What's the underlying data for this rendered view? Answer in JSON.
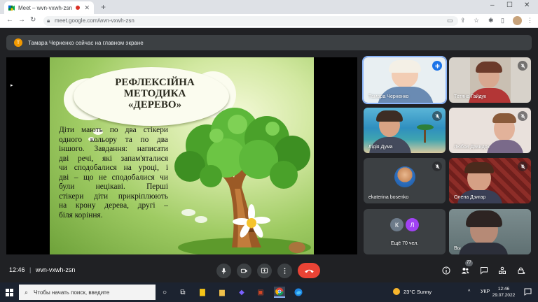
{
  "browser": {
    "tab_title": "Meet – wvn-vxwh-zsn",
    "tab_close": "✕",
    "new_tab": "+",
    "url": "meet.google.com/wvn-vxwh-zsn",
    "window_controls": [
      "–",
      "☐",
      "✕"
    ]
  },
  "banner": {
    "avatar_letter": "Т",
    "text": "Тамара Черненко сейчас на главном экране"
  },
  "slide": {
    "title_lines": [
      "РЕФЛЕКСІЙНА",
      "МЕТОДИКА",
      "«ДЕРЕВО»"
    ],
    "body_lines": [
      "Діти мають по два стікери",
      "одного кольору та по два",
      "іншого. Завдання: написати",
      "дві речі, які запам'яталися",
      "чи сподобалися на уроці, і",
      "дві – що не сподобалися чи",
      "були нецікаві. Перші",
      "стікери діти прикріплюють",
      "на крону дерева, другі –",
      "біля коріння."
    ]
  },
  "participants": [
    {
      "name": "Тамара Черненко",
      "mic": "speaking"
    },
    {
      "name": "Тетяна Гайдук",
      "mic": "muted"
    },
    {
      "name": "Лідія Дума",
      "mic": "muted"
    },
    {
      "name": "Любов Давидок",
      "mic": "muted"
    },
    {
      "name": "ekaterina bosenko",
      "mic": "muted"
    },
    {
      "name": "Олена Дзигар",
      "mic": "muted"
    },
    {
      "name": "Ещё 70 чел.",
      "avatars": [
        "К",
        "Л"
      ],
      "avatar_colors": [
        "#6d7b8a",
        "#a142f4"
      ]
    },
    {
      "name": "Вы",
      "mic": "none"
    }
  ],
  "meeting": {
    "time": "12:46",
    "code": "wvn-vxwh-zsn",
    "people_count": "77"
  },
  "taskbar": {
    "search_placeholder": "Чтобы начать поиск, введите",
    "weather": "23°C  Sunny",
    "language": "УКР",
    "time": "12:46",
    "date": "29.07.2022"
  },
  "colors": {
    "accent_blue": "#8ab4f8",
    "end_call_red": "#ea4335",
    "meet_bg": "#202124"
  }
}
